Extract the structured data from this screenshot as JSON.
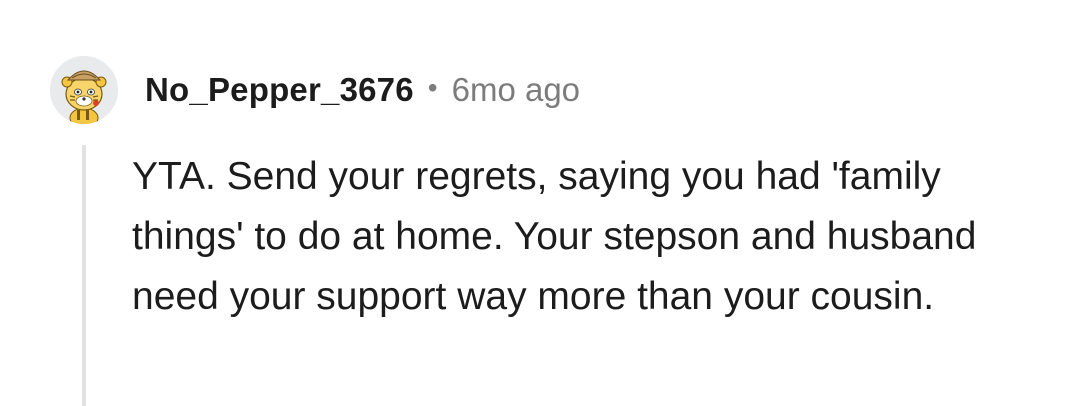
{
  "comment": {
    "author": "No_Pepper_3676",
    "separator": "•",
    "timestamp": "6mo ago",
    "text": "YTA. Send your regrets, saying you had 'family things' to do at home. Your stepson and husband need your support way more than your cousin."
  },
  "avatar": {
    "icon": "snoo-avatar-icon",
    "background": "#e9eaec",
    "accent": "#f4c542"
  },
  "colors": {
    "author": "#1c1c1c",
    "meta": "#7c7c7c",
    "thread_line": "#e2e2e2",
    "text": "#1c1c1c"
  }
}
